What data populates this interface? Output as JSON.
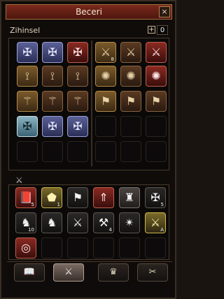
{
  "window": {
    "title": "Beceri",
    "close_label": "×"
  },
  "category": {
    "label": "Zihinsel",
    "plus_label": "+",
    "points": "0"
  },
  "top_left_grid": {
    "rows": [
      [
        "✠",
        "✠",
        "✠"
      ],
      [
        "⟟",
        "⟟",
        "⟟"
      ],
      [
        "⚚",
        "⚚",
        "⚚"
      ],
      [
        "✠",
        "✠",
        "✠"
      ],
      [
        "",
        "",
        ""
      ]
    ]
  },
  "top_right_grid": {
    "rows": [
      [
        "⚔",
        "⚔",
        "⚔"
      ],
      [
        "✺",
        "✺",
        "✺"
      ],
      [
        "⚑",
        "⚑",
        "⚑"
      ],
      [
        "",
        "",
        ""
      ],
      [
        "",
        "",
        ""
      ]
    ]
  },
  "weapon_section": {
    "icon": "sword-icon",
    "rows": [
      [
        {
          "icon": "book-icon",
          "label": "📕",
          "style": "red"
        },
        {
          "icon": "star-rune-icon",
          "label": "⬟",
          "style": "yellow"
        },
        {
          "icon": "flag-icon",
          "label": "⚑",
          "style": "dark2"
        },
        {
          "icon": "up-arrow-icon",
          "label": "⇑",
          "style": "red"
        },
        {
          "icon": "statue-icon",
          "label": "♜",
          "style": "gray"
        },
        {
          "icon": "emblem-icon",
          "label": "✠",
          "style": "dark2"
        }
      ],
      [
        {
          "icon": "horse-icon",
          "label": "♞",
          "style": "dark2",
          "badge": "10"
        },
        {
          "icon": "horse-head-icon",
          "label": "♞",
          "style": "dark2",
          "badge": ""
        },
        {
          "icon": "sword-icon",
          "label": "⚔",
          "style": "dark2",
          "badge": ""
        },
        {
          "icon": "axe-icon",
          "label": "⚒",
          "style": "dark2",
          "badge": ""
        },
        {
          "icon": "claw-icon",
          "label": "✴",
          "style": "dark2",
          "badge": ""
        },
        {
          "icon": "sword-shield-icon",
          "label": "⚔",
          "style": "yellow",
          "badge": ""
        }
      ],
      [
        {
          "icon": "target-icon",
          "label": "◎",
          "style": "red",
          "badge": ""
        },
        {
          "icon": "",
          "label": "",
          "style": "dark"
        },
        {
          "icon": "",
          "label": "",
          "style": "dark"
        },
        {
          "icon": "",
          "label": "",
          "style": "dark"
        },
        {
          "icon": "",
          "label": "",
          "style": "dark"
        },
        {
          "icon": "",
          "label": "",
          "style": "dark"
        }
      ]
    ]
  },
  "tabs": [
    {
      "name": "tab-book",
      "label": "📖"
    },
    {
      "name": "tab-sword",
      "label": "⚔"
    },
    {
      "name": "tab-crown",
      "label": "♛"
    },
    {
      "name": "tab-knife",
      "label": "✂"
    }
  ]
}
